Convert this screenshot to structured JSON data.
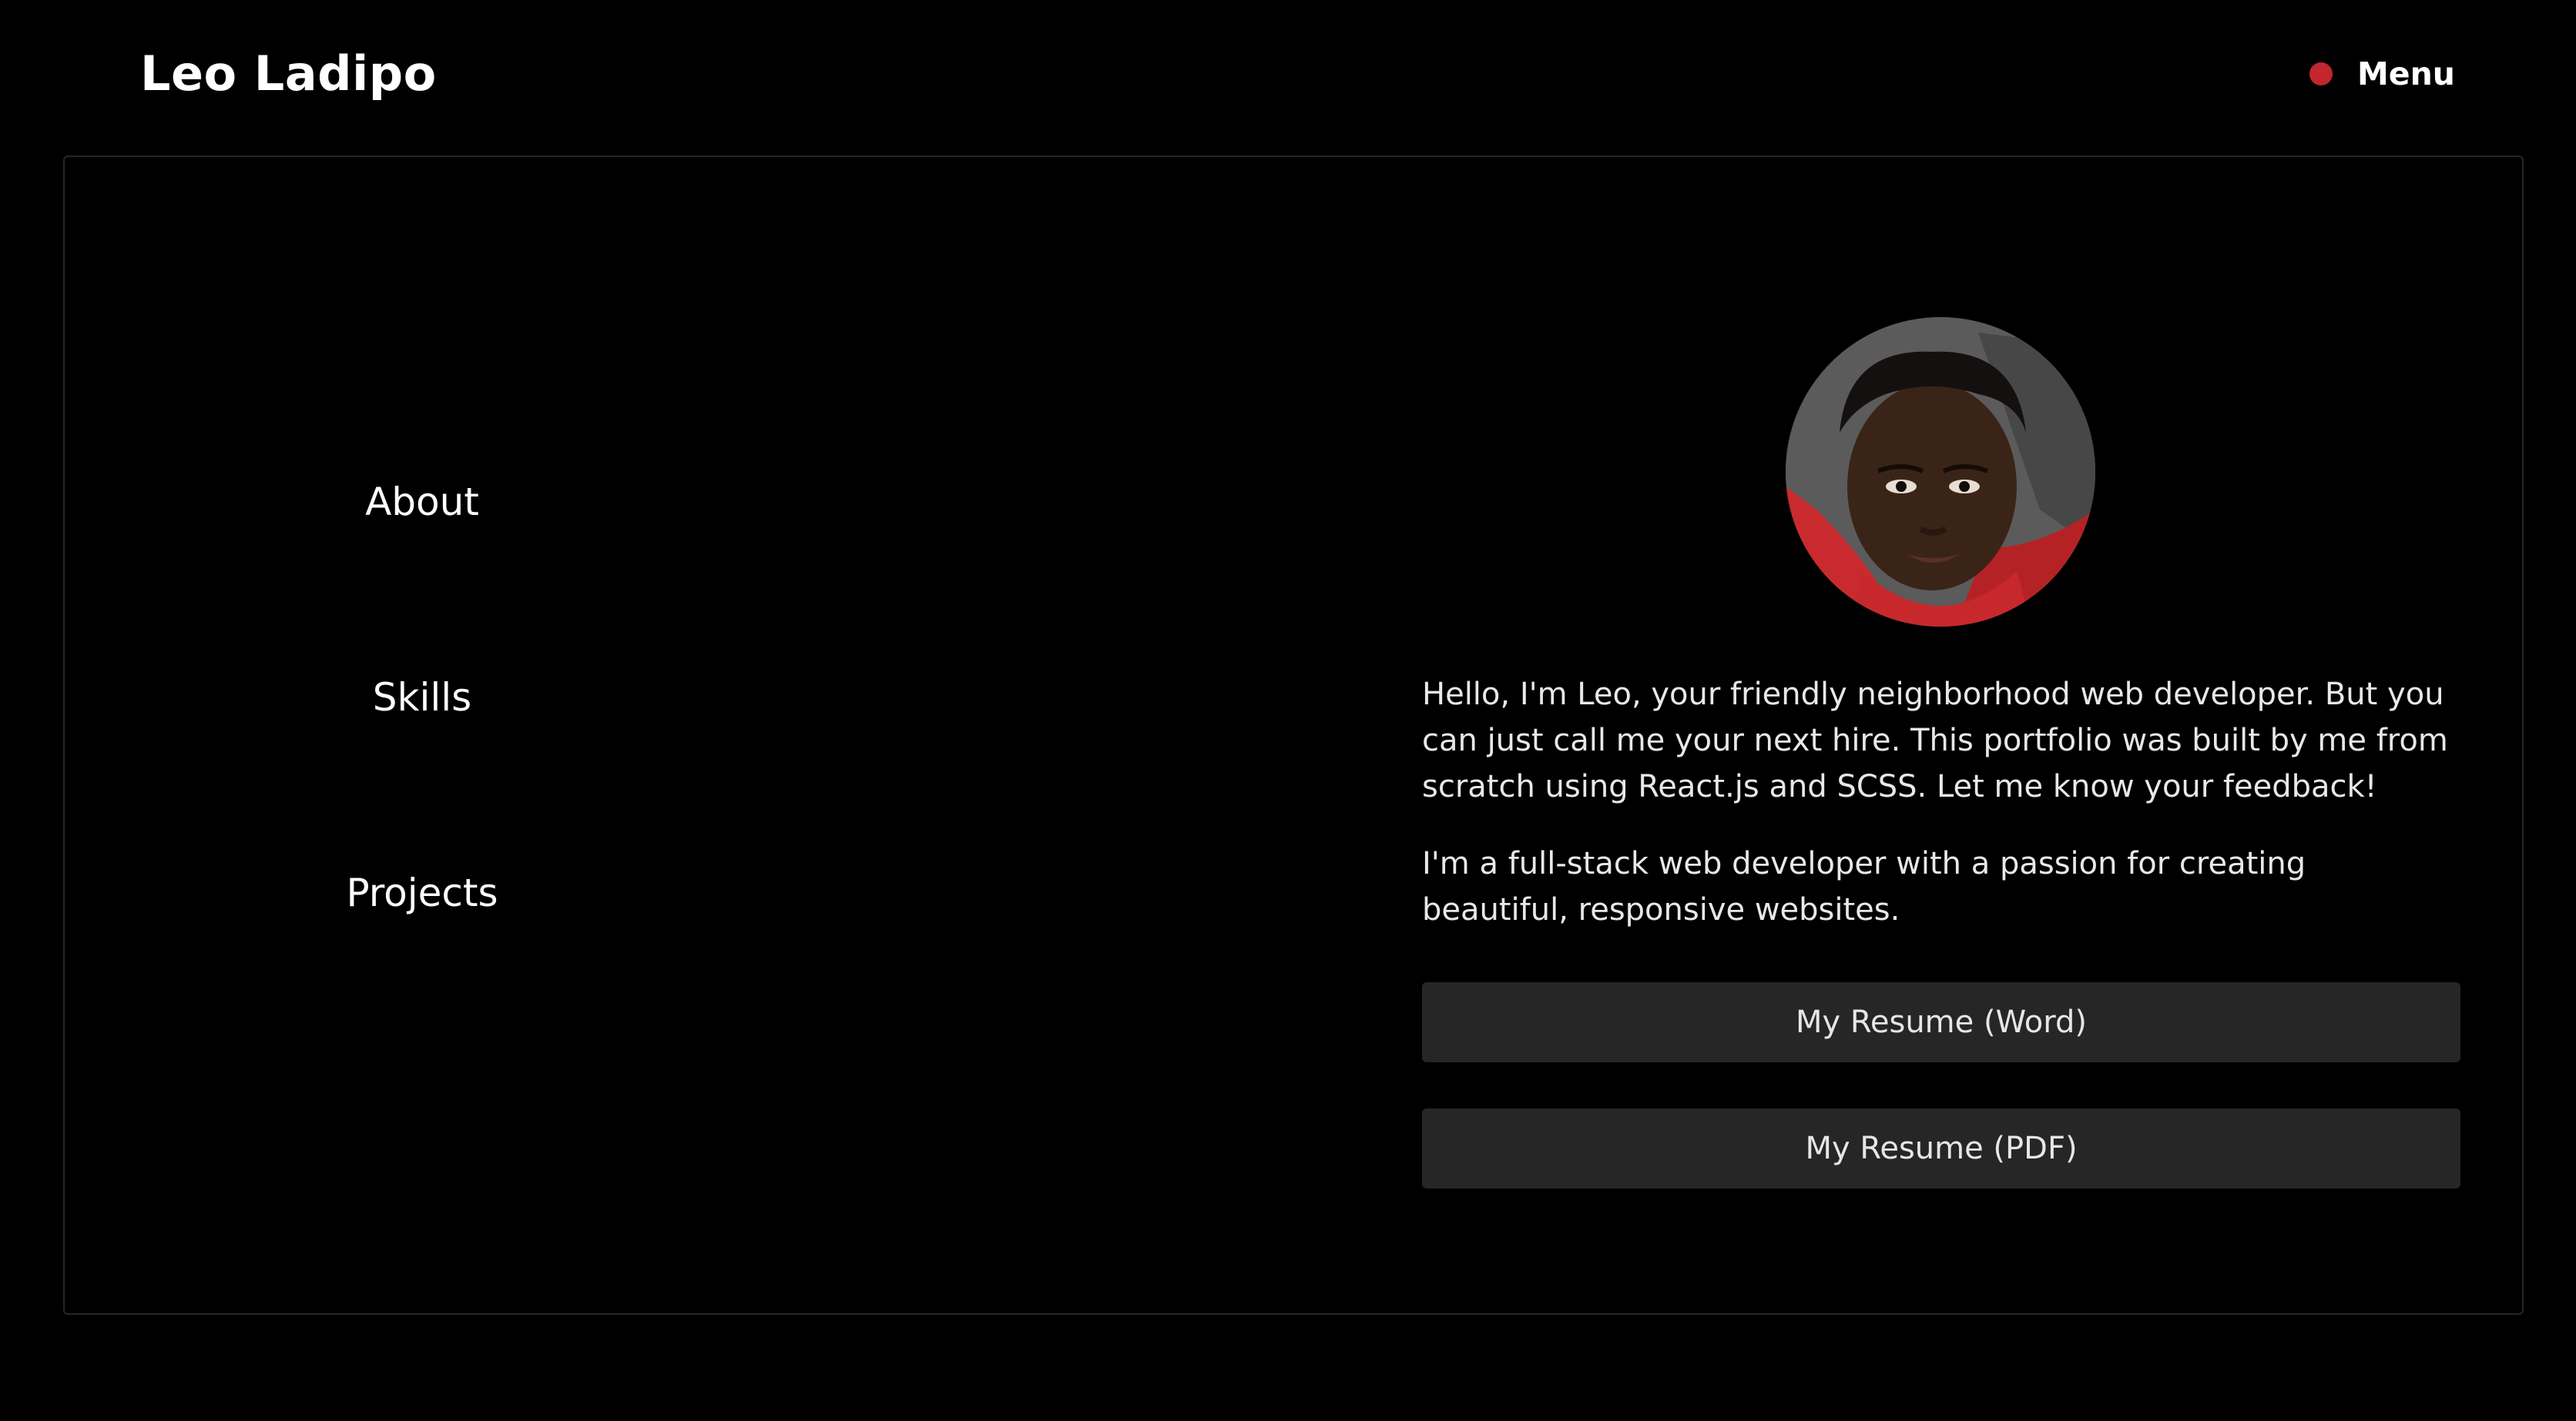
{
  "header": {
    "brand": "Leo Ladipo",
    "menu_label": "Menu",
    "menu_dot_color": "#c1272d"
  },
  "nav": {
    "items": [
      {
        "label": "About"
      },
      {
        "label": "Skills"
      },
      {
        "label": "Projects"
      }
    ]
  },
  "profile": {
    "avatar": "profile-photo",
    "bio": [
      "Hello, I'm Leo, your friendly neighborhood web developer. But you can just call me your next hire. This portfolio was built by me from scratch using React.js and SCSS. Let me know your feedback!",
      "I'm a full-stack web developer with a passion for creating beautiful, responsive websites."
    ]
  },
  "actions": {
    "resume_word": "My Resume (Word)",
    "resume_pdf": "My Resume (PDF)"
  },
  "colors": {
    "background": "#000000",
    "button_bg": "#262626",
    "accent": "#c1272d"
  }
}
